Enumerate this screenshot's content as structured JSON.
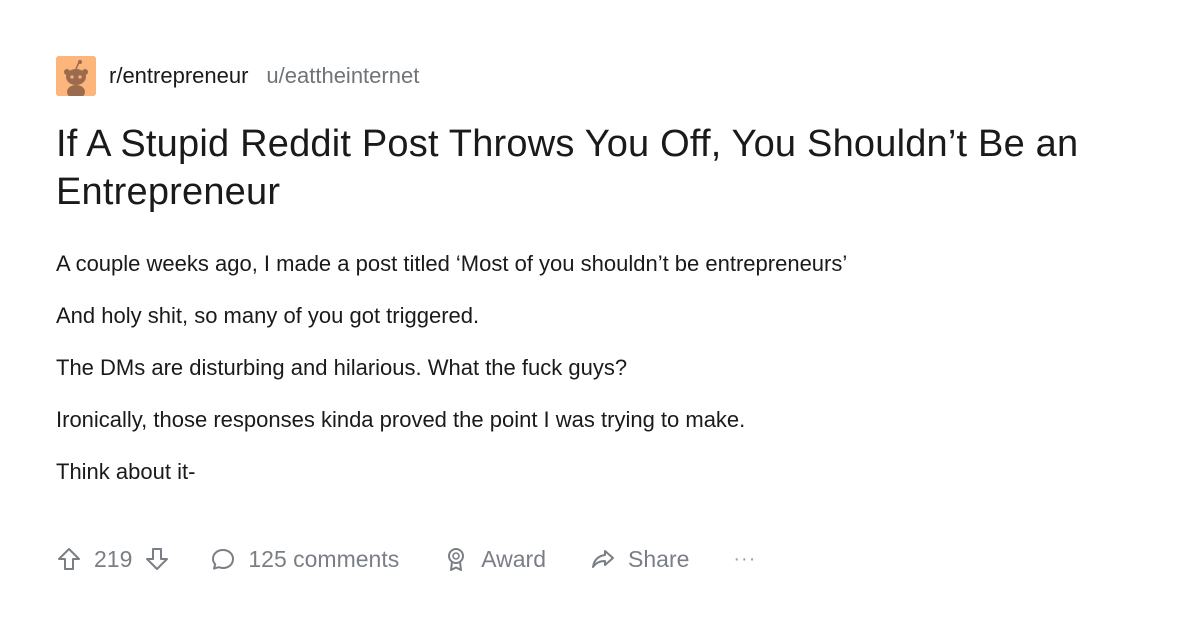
{
  "post": {
    "subreddit": "r/entrepreneur",
    "author": "u/eattheinternet",
    "title": "If A Stupid Reddit Post Throws You Off, You Shouldn’t Be an Entrepreneur",
    "paragraphs": [
      "A couple weeks ago, I made a post titled ‘Most of you shouldn’t be entrepreneurs’",
      "And holy shit, so many of you got triggered.",
      "The DMs are disturbing and hilarious. What the fuck guys?",
      "Ironically, those responses kinda proved the point I was trying to make.",
      "Think about it-"
    ]
  },
  "actions": {
    "upvote_icon": "arrow-up-icon",
    "vote_count": "219",
    "downvote_icon": "arrow-down-icon",
    "comments_icon": "comment-bubble-icon",
    "comments_label": "125 comments",
    "award_icon": "award-medal-icon",
    "award_label": "Award",
    "share_icon": "share-arrow-icon",
    "share_label": "Share",
    "more_label": "···"
  },
  "colors": {
    "avatar_bg": "#fcb57a",
    "text": "#1a1a1b",
    "muted": "#7a7f85"
  }
}
